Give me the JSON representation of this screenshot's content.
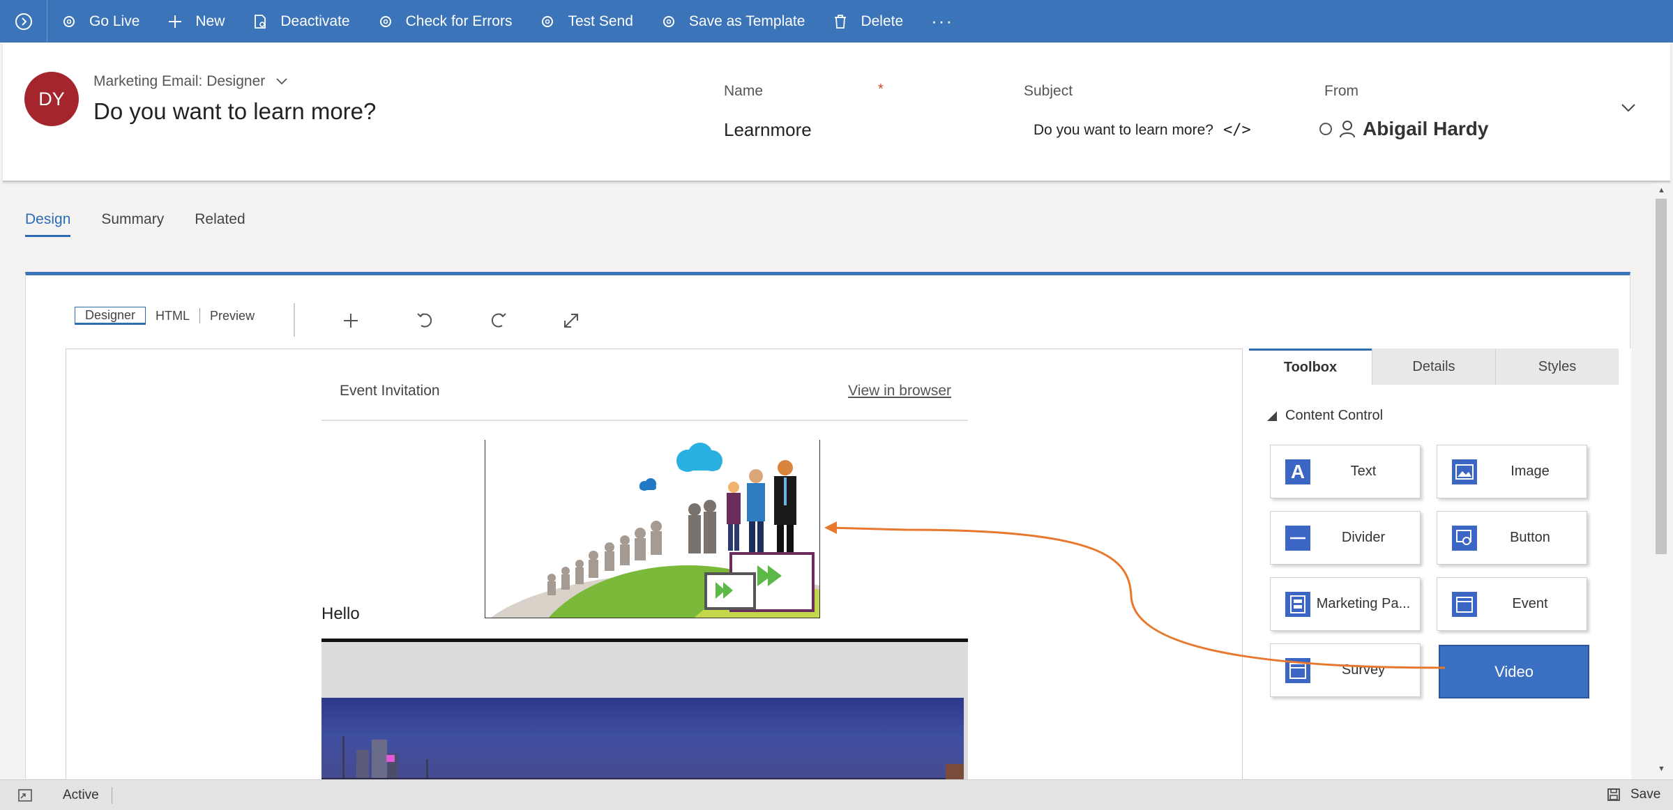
{
  "commandbar": {
    "items": [
      {
        "label": "Go Live",
        "icon": "gear-icon"
      },
      {
        "label": "New",
        "icon": "plus-icon"
      },
      {
        "label": "Deactivate",
        "icon": "document-icon"
      },
      {
        "label": "Check for Errors",
        "icon": "gear-icon"
      },
      {
        "label": "Test Send",
        "icon": "gear-icon"
      },
      {
        "label": "Save as Template",
        "icon": "gear-icon"
      },
      {
        "label": "Delete",
        "icon": "trash-icon"
      }
    ],
    "more": "···"
  },
  "header": {
    "avatar_initials": "DY",
    "entity_label": "Marketing Email: Designer",
    "title": "Do you want to learn more?",
    "fields": {
      "name_label": "Name",
      "name_required": "*",
      "name_value": "Learnmore",
      "subject_label": "Subject",
      "subject_value": "Do you want to learn more?",
      "subject_code": "</>",
      "from_label": "From",
      "from_value": "Abigail Hardy"
    }
  },
  "tabs": [
    "Design",
    "Summary",
    "Related"
  ],
  "designer": {
    "modes": [
      "Designer",
      "HTML",
      "Preview"
    ],
    "email": {
      "header_left": "Event Invitation",
      "header_right": "View in browser",
      "greeting": "Hello"
    },
    "side_tabs": [
      "Toolbox",
      "Details",
      "Styles"
    ],
    "section": "Content Control",
    "tools": [
      {
        "label": "Text",
        "icon": "text-icon"
      },
      {
        "label": "Image",
        "icon": "image-icon"
      },
      {
        "label": "Divider",
        "icon": "divider-icon"
      },
      {
        "label": "Button",
        "icon": "button-icon"
      },
      {
        "label": "Marketing Pa...",
        "icon": "marketing-page-icon"
      },
      {
        "label": "Event",
        "icon": "calendar-icon"
      },
      {
        "label": "Survey",
        "icon": "calendar-icon"
      },
      {
        "label": "Video",
        "icon": "video-icon"
      }
    ]
  },
  "statusbar": {
    "status": "Active",
    "save": "Save"
  },
  "colors": {
    "accent": "#3b74b8",
    "avatar": "#a4262c",
    "drag_arrow": "#e8782e",
    "tool_icon": "#3b66c4"
  }
}
